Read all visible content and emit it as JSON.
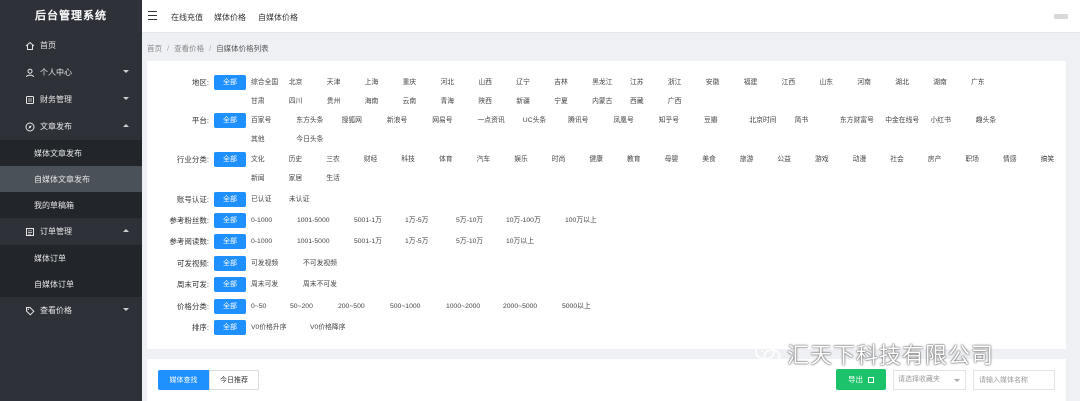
{
  "sidebar": {
    "title": "后台管理系统",
    "items": [
      {
        "label": "首页",
        "icon": "home-icon",
        "arrow": ""
      },
      {
        "label": "个人中心",
        "icon": "user-icon",
        "arrow": "down"
      },
      {
        "label": "财务管理",
        "icon": "finance-icon",
        "arrow": "down"
      },
      {
        "label": "文章发布",
        "icon": "compass-icon",
        "arrow": "up"
      }
    ],
    "article_sub": [
      {
        "label": "媒体文章发布",
        "active": false
      },
      {
        "label": "自媒体文章发布",
        "active": true
      },
      {
        "label": "我的草稿箱",
        "active": false
      }
    ],
    "order": {
      "label": "订单管理",
      "icon": "order-icon",
      "arrow": "up"
    },
    "order_sub": [
      {
        "label": "媒体订单"
      },
      {
        "label": "自媒体订单"
      }
    ],
    "price": {
      "label": "查看价格",
      "icon": "tag-icon",
      "arrow": "down"
    }
  },
  "topbar": {
    "links": [
      "在线充值",
      "媒体价格",
      "自媒体价格"
    ]
  },
  "breadcrumb": [
    "首页",
    "查看价格",
    "自媒体价格列表"
  ],
  "filters": [
    {
      "label": "地区:",
      "all": "全部",
      "options": [
        "综合全国",
        "北京",
        "天津",
        "上海",
        "重庆",
        "河北",
        "山西",
        "辽宁",
        "吉林",
        "黑龙江",
        "江苏",
        "浙江",
        "安徽",
        "福建",
        "江西",
        "山东",
        "河南",
        "湖北",
        "湖南",
        "广东",
        "甘肃",
        "四川",
        "贵州",
        "海南",
        "云南",
        "青海",
        "陕西",
        "新疆",
        "宁夏",
        "内蒙古",
        "西藏",
        "广西"
      ]
    },
    {
      "label": "平台:",
      "all": "全部",
      "options": [
        "百家号",
        "东方头条",
        "搜狐网",
        "新浪号",
        "网易号",
        "一点资讯",
        "UC头条",
        "腾讯号",
        "凤凰号",
        "知乎号",
        "豆瓣",
        "北京时间",
        "简书",
        "东方财富号",
        "中金在线号",
        "小红书",
        "趣头条",
        "其他",
        "今日头条"
      ]
    },
    {
      "label": "行业分类:",
      "all": "全部",
      "options": [
        "文化",
        "历史",
        "三农",
        "财经",
        "科技",
        "体育",
        "汽车",
        "娱乐",
        "时尚",
        "健康",
        "教育",
        "母婴",
        "美食",
        "旅游",
        "公益",
        "游戏",
        "动漫",
        "社会",
        "房产",
        "职场",
        "情感",
        "搞笑",
        "新闻",
        "家居",
        "生活"
      ]
    },
    {
      "label": "账号认证:",
      "all": "全部",
      "options": [
        "已认证",
        "未认证"
      ]
    },
    {
      "label": "参考粉丝数:",
      "all": "全部",
      "options": [
        "0-1000",
        "1001-5000",
        "5001-1万",
        "1万-5万",
        "5万-10万",
        "10万-100万",
        "100万以上"
      ]
    },
    {
      "label": "参考阅读数:",
      "all": "全部",
      "options": [
        "0-1000",
        "1001-5000",
        "5001-1万",
        "1万-5万",
        "5万-10万",
        "10万以上"
      ]
    },
    {
      "label": "可发视频:",
      "all": "全部",
      "options": [
        "可发视频",
        "不可发视频"
      ]
    },
    {
      "label": "周末可发:",
      "all": "全部",
      "options": [
        "周末可发",
        "周末不可发"
      ]
    },
    {
      "label": "价格分类:",
      "all": "全部",
      "options": [
        "0~50",
        "50~200",
        "200~500",
        "500~1000",
        "1000~2000",
        "2000~5000",
        "5000以上"
      ]
    },
    {
      "label": "排序:",
      "all": "全部",
      "options": [
        "V0价格升序",
        "V0价格降序"
      ]
    }
  ],
  "bottom": {
    "tab_search": "媒体查找",
    "tab_recommend": "今日推荐",
    "export": "导出",
    "select_placeholder": "请选择收藏夹",
    "input_placeholder": "请输入媒体名称"
  },
  "watermark": "汇天下科技有限公司"
}
